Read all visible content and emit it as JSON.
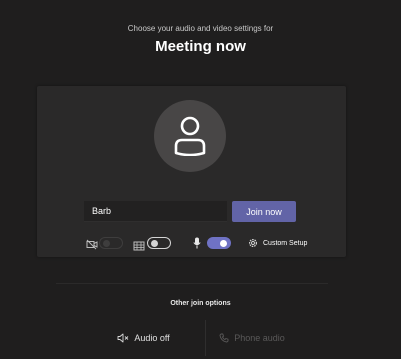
{
  "header": {
    "subtitle": "Choose your audio and video settings for",
    "title": "Meeting now"
  },
  "preview": {
    "name_value": "Barb",
    "join_label": "Join now",
    "controls": {
      "camera": {
        "icon": "camera-off-icon",
        "state": "disabled"
      },
      "blur": {
        "icon": "background-blur-icon",
        "state": "off"
      },
      "mic": {
        "icon": "microphone-icon",
        "state": "on"
      },
      "custom_setup_label": "Custom Setup",
      "custom_setup_icon": "gear-icon"
    }
  },
  "other_join": {
    "label": "Other join options",
    "audio_off_label": "Audio off",
    "audio_off_icon": "speaker-off-icon",
    "phone_audio_label": "Phone audio",
    "phone_audio_icon": "phone-icon"
  },
  "colors": {
    "background": "#1f1e1e",
    "panel": "#2a2929",
    "accent": "#6264a7",
    "toggle_on": "#6f72c4"
  }
}
